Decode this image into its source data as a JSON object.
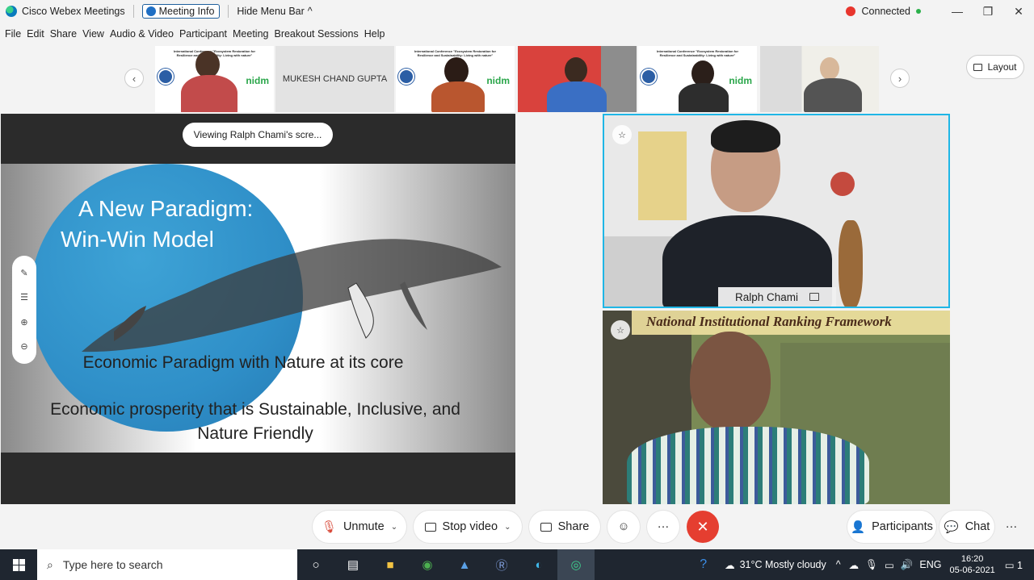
{
  "titlebar": {
    "app_title": "Cisco Webex Meetings",
    "meeting_info": "Meeting Info",
    "hide_menu": "Hide Menu Bar",
    "hide_menu_chevron": "^",
    "status": "Connected",
    "minimize": "—",
    "restore": "❐",
    "close": "✕"
  },
  "menu": [
    "File",
    "Edit",
    "Share",
    "View",
    "Audio & Video",
    "Participant",
    "Meeting",
    "Breakout Sessions",
    "Help"
  ],
  "strip": {
    "prev": "‹",
    "next": "›",
    "name_tile": "MUKESH CHAND GUPTA",
    "poster_text": "International Conference \"Ecosystem Restoration for Resilience and Sustainability: Living with nature\"",
    "nidm_logo": "nidm",
    "layout_label": "Layout"
  },
  "share": {
    "viewing": "Viewing Ralph Chami's scre...",
    "slide": {
      "title_line1": "A New Paradigm:",
      "title_line2": "Win-Win Model",
      "line1": "Economic Paradigm with Nature at its core",
      "line2a": "Economic prosperity that is Sustainable, Inclusive, and",
      "line2b": "Nature Friendly"
    },
    "tools": [
      "pen-icon",
      "pointer-icon",
      "zoom-in-icon",
      "zoom-out-icon"
    ]
  },
  "videos": {
    "main_name": "Ralph Chami",
    "second_banner": "National Institutional Ranking Framework"
  },
  "controls": {
    "unmute": "Unmute",
    "stop_video": "Stop video",
    "share": "Share",
    "reactions": "☺",
    "more": "···",
    "end": "✕",
    "participants": "Participants",
    "chat": "Chat",
    "panel_more": "···"
  },
  "taskbar": {
    "search_placeholder": "Type here to search",
    "weather": "31°C  Mostly cloudy",
    "language": "ENG",
    "time": "16:20",
    "date": "05-06-2021",
    "notifications": "1"
  },
  "colors": {
    "accent_border": "#1fb6e6",
    "end_call": "#e53e30",
    "connected_dot": "#2bb04a",
    "slide_circle": "#2f8fc8"
  }
}
